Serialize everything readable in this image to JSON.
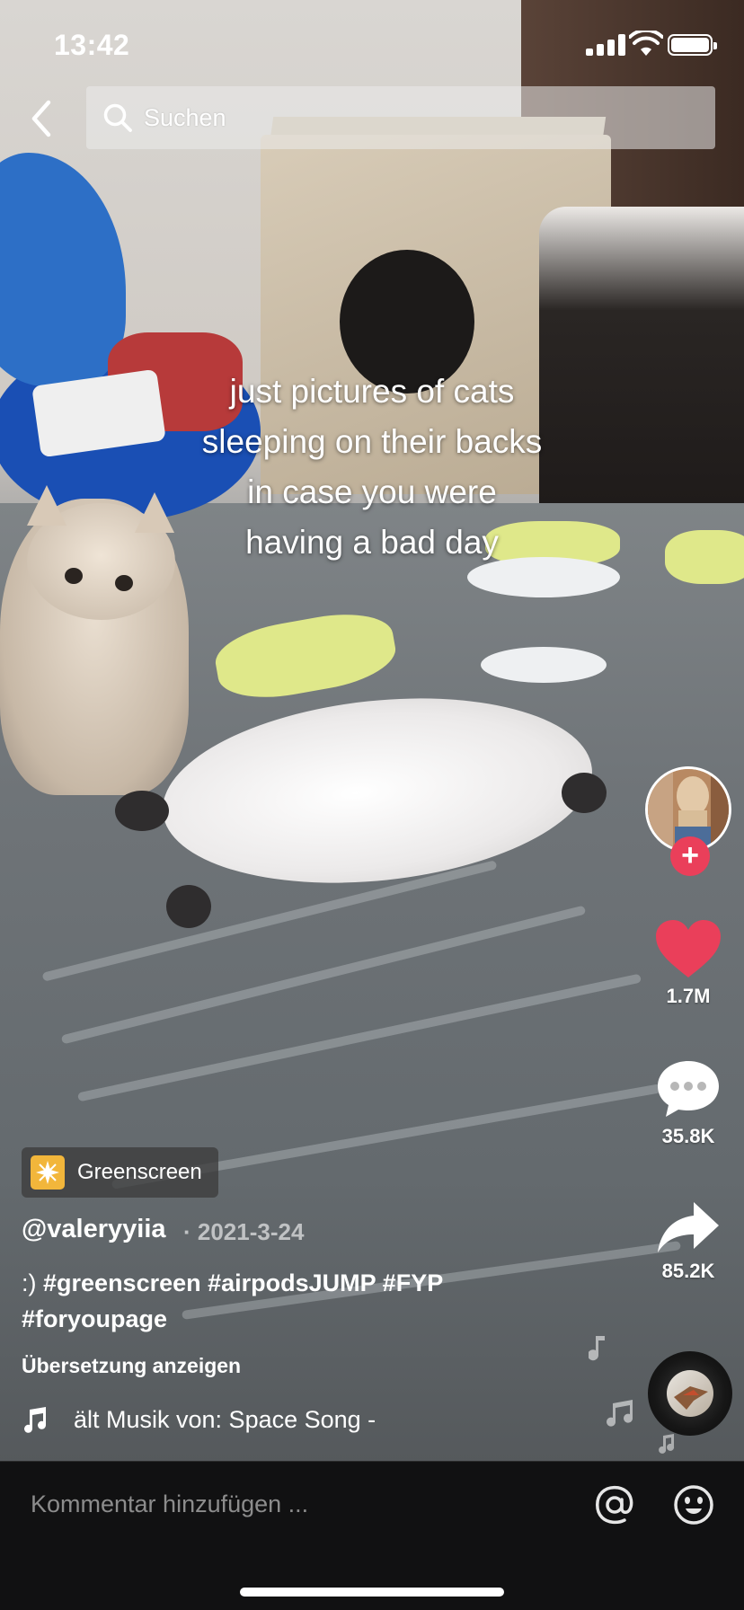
{
  "status_bar": {
    "time": "13:42"
  },
  "top_nav": {
    "search_placeholder": "Suchen"
  },
  "video": {
    "caption_lines": [
      "just pictures of cats",
      "sleeping on their backs",
      "in case you were",
      "having a bad day"
    ]
  },
  "actions": {
    "likes": "1.7M",
    "comments": "35.8K",
    "shares": "85.2K",
    "follow_symbol": "+"
  },
  "post": {
    "effect_label": "Greenscreen",
    "username": "@valeryyiia",
    "date": "· 2021-3-24",
    "description_prefix": ":)",
    "hashtags_line1": "#greenscreen #airpodsJUMP #FYP",
    "hashtags_line2": "#foryoupage",
    "translate_label": "Übersetzung anzeigen",
    "music_text": "ält Musik von: Space Song -"
  },
  "comment_bar": {
    "placeholder": "Kommentar hinzufügen ..."
  },
  "colors": {
    "like_red": "#ea3f5a",
    "follow_red": "#ea3f5a",
    "effect_badge_yellow": "#f2b63b",
    "comment_bar_bg": "#111112"
  },
  "icons": [
    "back-chevron-icon",
    "search-icon",
    "heart-icon",
    "comment-bubble-icon",
    "share-arrow-icon",
    "music-note-icon",
    "at-sign-icon",
    "emoji-icon",
    "sparkle-effect-icon",
    "signal-icon",
    "wifi-icon",
    "battery-icon"
  ]
}
